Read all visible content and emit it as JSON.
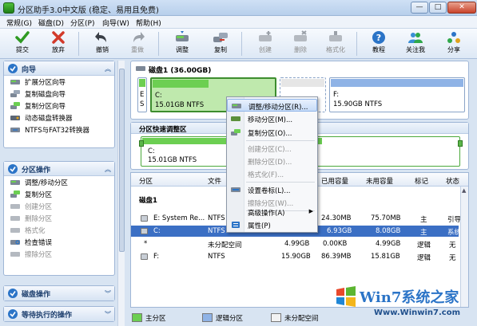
{
  "window": {
    "title": "分区助手3.0中文版 (稳定、易用且免费)",
    "min": "—",
    "max": "□",
    "close": "✕"
  },
  "menu": [
    "常规(G)",
    "磁盘(D)",
    "分区(P)",
    "向导(W)",
    "帮助(H)"
  ],
  "toolbar": {
    "commit": "提交",
    "discard": "放弃",
    "undo": "撤销",
    "redo": "重做",
    "resize": "调整",
    "copy": "复制",
    "create": "创建",
    "delete": "删除",
    "format": "格式化",
    "tutorial": "教程",
    "follow": "关注我",
    "share": "分享"
  },
  "sidebar": {
    "wizard": {
      "title": "向导",
      "items": [
        "扩展分区向导",
        "复制磁盘向导",
        "复制分区向导",
        "动态磁盘转换器",
        "NTFS与FAT32转换器"
      ]
    },
    "partition_ops": {
      "title": "分区操作",
      "items": [
        "调整/移动分区",
        "复制分区",
        "创建分区",
        "删除分区",
        "格式化",
        "检查错误",
        "擦除分区"
      ]
    },
    "disk_ops": {
      "title": "磁盘操作"
    },
    "pending_ops": {
      "title": "等待执行的操作"
    }
  },
  "disk_map": {
    "title": "磁盘1 (36.00GB)",
    "seg_e": {
      "label": "E",
      "size": "S"
    },
    "seg_c": {
      "label": "C:",
      "size": "15.01GB NTFS"
    },
    "seg_f": {
      "label": "F:",
      "size": "15.90GB NTFS"
    }
  },
  "resize_panel": {
    "title": "分区快速调整区",
    "label": "C:",
    "size": "15.01GB NTFS"
  },
  "table": {
    "headers": [
      "分区",
      "文件",
      "已用容量",
      "未用容量",
      "标记",
      "状态"
    ],
    "disk_label": "磁盘1",
    "rows": [
      {
        "name": "E: System Re...",
        "fs": "NTFS",
        "used": "24.30MB",
        "free": "75.70MB",
        "flag": "主",
        "status": "引导"
      },
      {
        "name": "C:",
        "fs": "NTFS",
        "used": "6.93GB",
        "free": "8.08GB",
        "flag": "主",
        "status": "系统"
      },
      {
        "name": "*",
        "fs": "未分配空间",
        "cap": "4.99GB",
        "used": "0.00KB",
        "free": "4.99GB",
        "flag": "逻辑",
        "status": "无"
      },
      {
        "name": "F:",
        "fs": "NTFS",
        "cap": "15.90GB",
        "used": "86.39MB",
        "free": "15.81GB",
        "flag": "逻辑",
        "status": "无"
      }
    ]
  },
  "context_menu": {
    "items": [
      "调整/移动分区(R)...",
      "移动分区(M)...",
      "复制分区(O)...",
      "创建分区(C)...",
      "删除分区(D)...",
      "格式化(F)...",
      "设置卷标(L)...",
      "擦除分区(W)...",
      "高级操作(A)",
      "属性(P)"
    ]
  },
  "legend": {
    "primary": "主分区",
    "logical": "逻辑分区",
    "unallocated": "未分配空间"
  },
  "watermark": {
    "brand": "Win7系统之家",
    "url": "Www.Winwin7.com"
  },
  "colors": {
    "primary_green": "#6ccf52",
    "logical_blue": "#8fb3e6",
    "selection": "#3b6fc4"
  }
}
